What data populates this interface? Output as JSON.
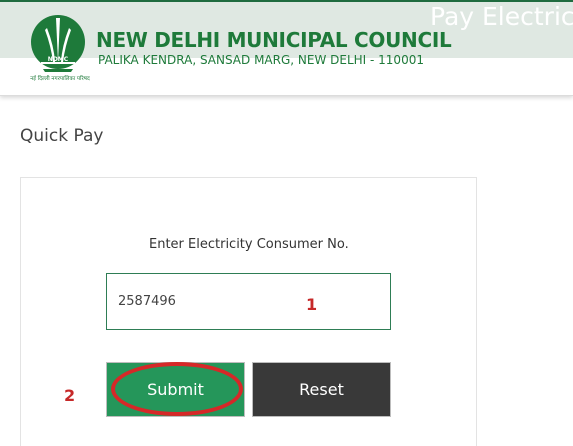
{
  "header": {
    "banner_title": "Pay Electric",
    "org_name": "NEW DELHI MUNICIPAL COUNCIL",
    "org_address": "PALIKA KENDRA, SANSAD MARG, NEW DELHI - 110001",
    "logo_caption": "नई दिल्ली नगरपालिका परिषद",
    "logo_acronym": "NDMC"
  },
  "main": {
    "page_title": "Quick Pay",
    "form": {
      "field_label": "Enter Electricity Consumer No.",
      "consumer_no_value": "2587496",
      "submit_label": "Submit",
      "reset_label": "Reset"
    }
  },
  "annotations": {
    "step1": "1",
    "step2": "2",
    "highlight_color": "#d62828"
  },
  "colors": {
    "brand_green": "#1e7a3a",
    "submit_green": "#25965a",
    "reset_dark": "#393939",
    "header_band": "#dfe8e2"
  }
}
